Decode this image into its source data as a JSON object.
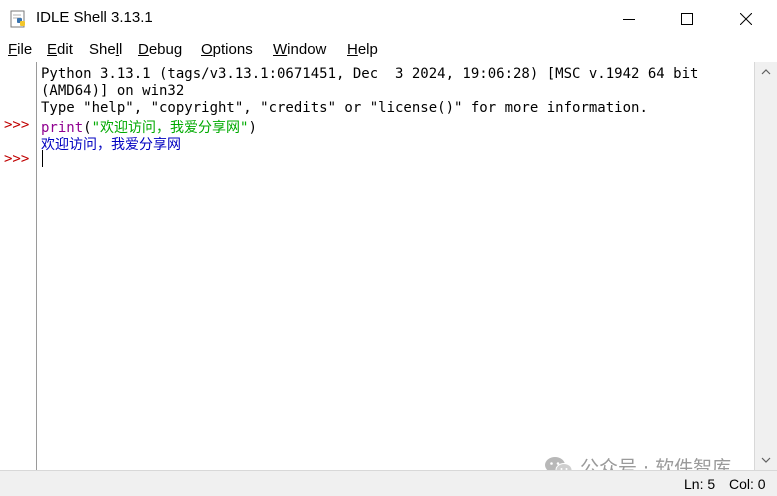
{
  "window": {
    "title": "IDLE Shell 3.13.1",
    "icons": {
      "app": "python-idle-icon",
      "minimize": "minimize-icon",
      "maximize": "maximize-icon",
      "close": "close-icon"
    }
  },
  "menu": {
    "items": [
      {
        "mnemonic": "F",
        "rest": "ile"
      },
      {
        "mnemonic": "E",
        "rest": "dit"
      },
      {
        "pre": "She",
        "mnemonic": "l",
        "rest": "l"
      },
      {
        "mnemonic": "D",
        "rest": "ebug"
      },
      {
        "mnemonic": "O",
        "rest": "ptions"
      },
      {
        "mnemonic": "W",
        "rest": "indow"
      },
      {
        "mnemonic": "H",
        "rest": "elp"
      }
    ]
  },
  "shell": {
    "lines": [
      "Python 3.13.1 (tags/v3.13.1:0671451, Dec  3 2024, 19:06:28) [MSC v.1942 64 bit",
      "(AMD64)] on win32",
      "Type \"help\", \"copyright\", \"credits\" or \"license()\" for more information."
    ],
    "prompt": ">>>",
    "input_func": "print",
    "input_open": "(",
    "input_string": "\"欢迎访问，我爱分享网\"",
    "input_close": ")",
    "output": "欢迎访问，我爱分享网"
  },
  "status": {
    "line": "Ln: 5",
    "col": "Col: 0"
  },
  "watermark": {
    "text": "公众号 · 软件智库",
    "icon": "wechat-icon"
  },
  "colors": {
    "prompt": "#c00000",
    "builtin": "#900090",
    "string": "#00aa00",
    "output": "#0000c0"
  }
}
